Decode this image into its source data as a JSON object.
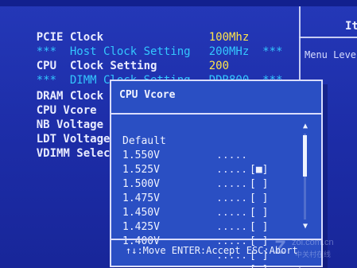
{
  "bios_menu": {
    "items": [
      {
        "label": "PCIE Clock",
        "value": "100Mhz",
        "style": "primary"
      },
      {
        "label": "***  Host Clock Setting",
        "value": "200MHz  ***",
        "style": "secondary"
      },
      {
        "label": "CPU  Clock Setting",
        "value": "200",
        "style": "primary"
      },
      {
        "label": "***  DIMM Clock Setting",
        "value": "DDR800  ***",
        "style": "secondary"
      },
      {
        "label": "DRAM Clock at Nex",
        "value": "",
        "style": "primary"
      },
      {
        "label": "CPU Vcore",
        "value": "",
        "style": "primary"
      },
      {
        "label": "NB Voltage",
        "value": "",
        "style": "primary"
      },
      {
        "label": "LDT Voltage",
        "value": "",
        "style": "primary"
      },
      {
        "label": "VDIMM Select",
        "value": "",
        "style": "primary"
      }
    ]
  },
  "right_panel": {
    "top_text": "It",
    "menu_text": "Menu Leve"
  },
  "popup": {
    "title": "CPU Vcore",
    "options": [
      {
        "label": "Default",
        "dots": ".....",
        "box": "[■]"
      },
      {
        "label": "1.550V",
        "dots": ".....",
        "box": "[ ]"
      },
      {
        "label": "1.525V",
        "dots": ".....",
        "box": "[ ]"
      },
      {
        "label": "1.500V",
        "dots": ".....",
        "box": "[ ]"
      },
      {
        "label": "1.475V",
        "dots": ".....",
        "box": "[ ]"
      },
      {
        "label": "1.450V",
        "dots": ".....",
        "box": "[ ]"
      },
      {
        "label": "1.425V",
        "dots": ".....",
        "box": "[ ]"
      },
      {
        "label": "1.400V",
        "dots": ".....",
        "box": "[ ]"
      }
    ],
    "footer": "↑↓:Move ENTER:Accept ESC:Abort"
  },
  "watermark": {
    "logo": "Z",
    "url": "zol.com.cn",
    "text": "中关村在线"
  },
  "colors": {
    "background": "#1f2fae",
    "popup_bg": "#2a4fc3",
    "text_primary": "#e9ecff",
    "text_secondary": "#33c7ff",
    "value_highlight": "#ffe54a"
  }
}
